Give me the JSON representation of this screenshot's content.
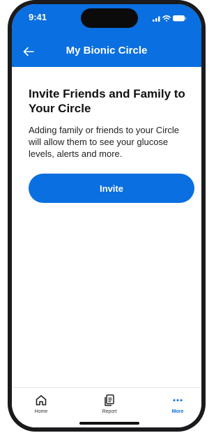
{
  "status_bar": {
    "time": "9:41"
  },
  "header": {
    "title": "My Bionic Circle",
    "back_icon": "arrow-left-icon"
  },
  "main": {
    "heading": "Invite Friends and Family to Your Circle",
    "description": "Adding family or friends to your Circle will allow them to see your glucose levels, alerts and more.",
    "invite_label": "Invite"
  },
  "tabbar": {
    "items": [
      {
        "label": "Home",
        "icon": "home-icon",
        "active": false
      },
      {
        "label": "Report",
        "icon": "report-icon",
        "active": false
      },
      {
        "label": "More",
        "icon": "more-icon",
        "active": true
      }
    ]
  },
  "colors": {
    "brand_blue": "#0a6fe0",
    "frame": "#1b1b1d"
  }
}
